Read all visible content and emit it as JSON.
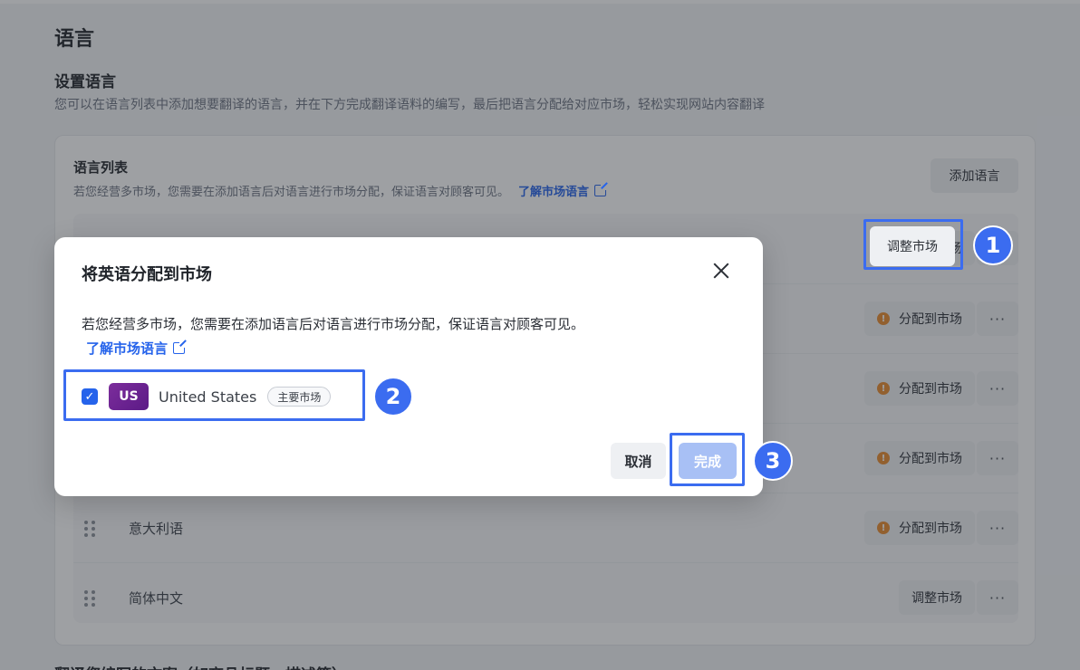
{
  "page": {
    "title": "语言",
    "section_title": "设置语言",
    "section_desc": "您可以在语言列表中添加想要翻译的语言，并在下方完成翻译语料的编写，最后把语言分配给对应市场，轻松实现网站内容翻译",
    "next_section_title": "翻译您编写的文案（如商品标题、描述等）"
  },
  "language_list": {
    "title": "语言列表",
    "desc": "若您经营多市场，您需要在添加语言后对语言进行市场分配，保证语言对顾客可见。",
    "link": "了解市场语言",
    "add_button": "添加语言",
    "rows": [
      {
        "name": "",
        "action": "调整市场",
        "more": "···"
      },
      {
        "name": "",
        "action": "分配到市场",
        "more": "···"
      },
      {
        "name": "",
        "action": "分配到市场",
        "more": "···"
      },
      {
        "name": "",
        "action": "分配到市场",
        "more": "···"
      },
      {
        "name": "意大利语",
        "action": "分配到市场",
        "more": "···"
      },
      {
        "name": "简体中文",
        "action": "调整市场",
        "more": "···"
      }
    ]
  },
  "modal": {
    "title": "将英语分配到市场",
    "desc": "若您经营多市场，您需要在添加语言后对语言进行市场分配，保证语言对顾客可见。",
    "link": "了解市场语言",
    "market": {
      "code": "US",
      "name": "United States",
      "tag": "主要市场",
      "checked": true
    },
    "cancel": "取消",
    "done": "完成"
  },
  "steps": [
    "1",
    "2",
    "3"
  ],
  "colors": {
    "accent": "#3b6cf0",
    "link": "#2563eb",
    "warning": "#ea8a2d",
    "done_disabled": "#a8c0f5"
  }
}
